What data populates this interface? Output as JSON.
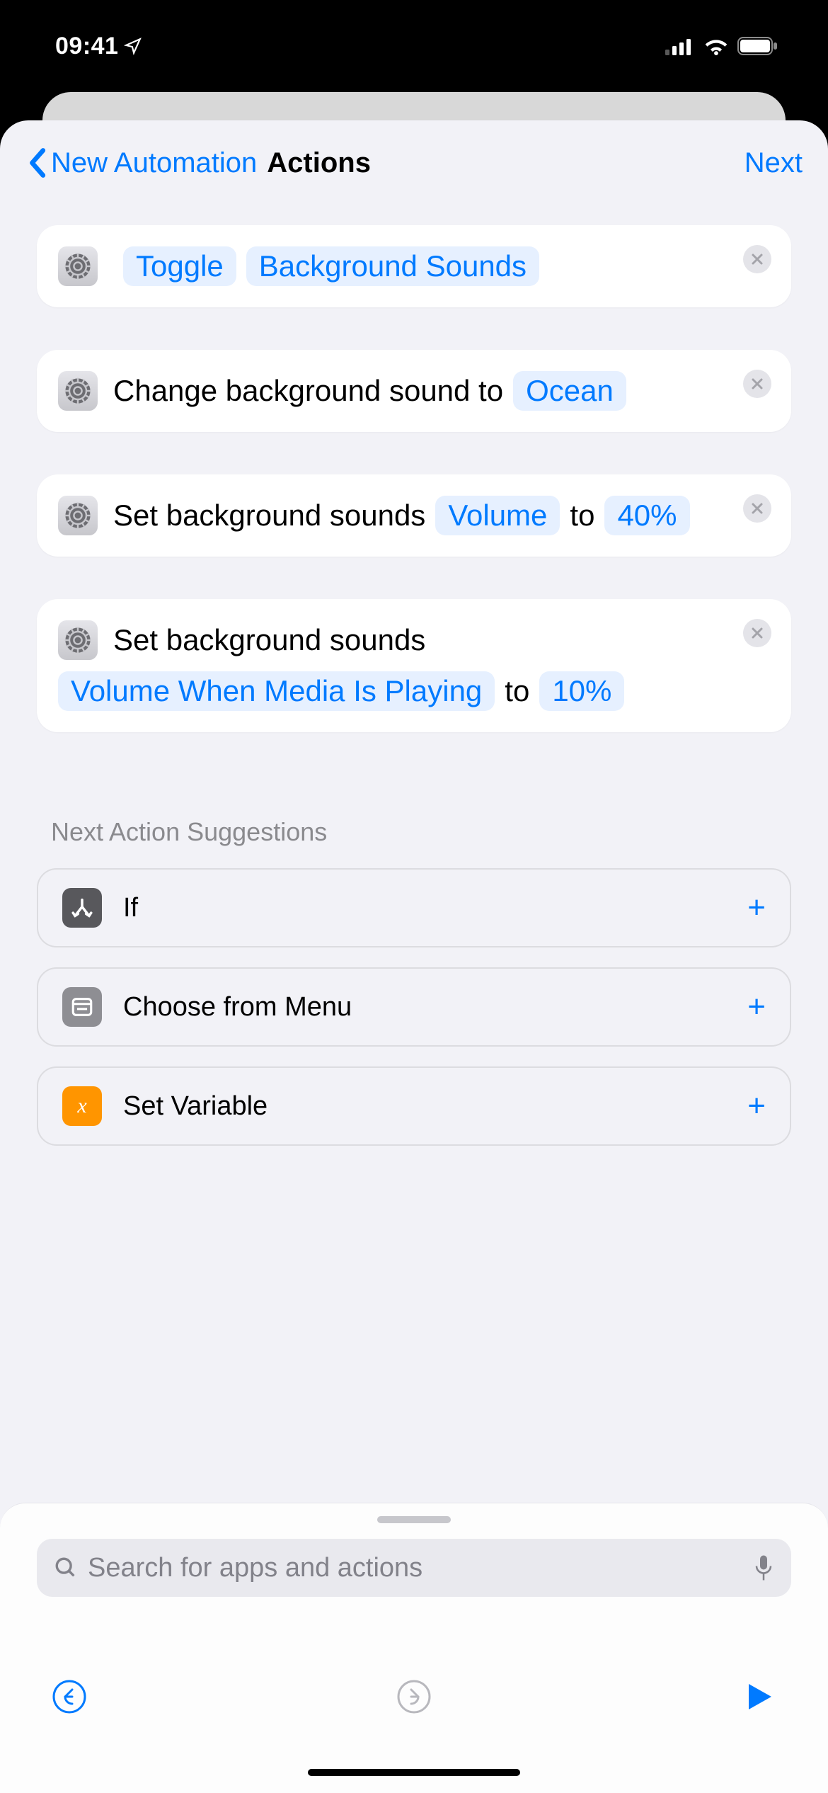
{
  "status": {
    "time": "09:41"
  },
  "nav": {
    "back": "New Automation",
    "title": "Actions",
    "next": "Next"
  },
  "actions": [
    {
      "prefix": "",
      "parts": [
        {
          "type": "token",
          "value": "Toggle"
        },
        {
          "type": "token",
          "value": "Background Sounds"
        }
      ]
    },
    {
      "prefix": "Change background sound to",
      "parts": [
        {
          "type": "token",
          "value": "Ocean"
        }
      ]
    },
    {
      "prefix": "Set background sounds",
      "parts": [
        {
          "type": "token",
          "value": "Volume"
        },
        {
          "type": "static",
          "value": "to"
        },
        {
          "type": "token",
          "value": "40%"
        }
      ]
    },
    {
      "prefix": "Set background sounds",
      "parts": [
        {
          "type": "token",
          "value": "Volume When Media Is Playing"
        },
        {
          "type": "static",
          "value": "to"
        },
        {
          "type": "token",
          "value": "10%"
        }
      ]
    }
  ],
  "suggestions_title": "Next Action Suggestions",
  "suggestions": [
    {
      "label": "If",
      "icon": "if"
    },
    {
      "label": "Choose from Menu",
      "icon": "menu"
    },
    {
      "label": "Set Variable",
      "icon": "var"
    }
  ],
  "search": {
    "placeholder": "Search for apps and actions"
  }
}
